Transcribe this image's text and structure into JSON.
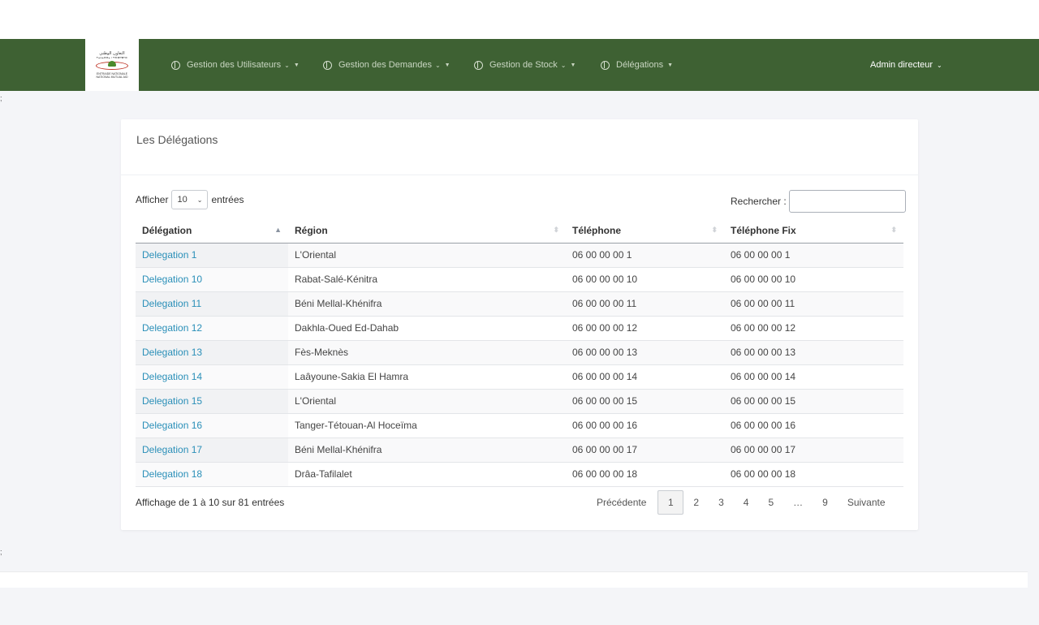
{
  "navbar": {
    "logo": {
      "arabic": "التعاون الوطني",
      "latin": "ⵜⴰⵡⴰⵙⵙⴰ ⵏ ⵜⵙⵏⵓⵖⵓⵢⵉⵏ",
      "name_line1": "ENTRAIDE NATIONALE",
      "name_line2": "NATIONAL MUTUAL AID"
    },
    "items": [
      {
        "label": "Gestion des Utilisateurs",
        "icon": "globe-icon"
      },
      {
        "label": "Gestion des Demandes",
        "icon": "globe-icon"
      },
      {
        "label": "Gestion de Stock",
        "icon": "globe-icon"
      },
      {
        "label": "Délégations",
        "icon": "globe-icon"
      }
    ],
    "user": "Admin directeur",
    "bg_color": "#3e6133"
  },
  "stray_marks": [
    ";",
    ";"
  ],
  "card": {
    "title": "Les Délégations",
    "length": {
      "prefix": "Afficher",
      "value": "10",
      "suffix": "entrées"
    },
    "search": {
      "label": "Rechercher :",
      "value": ""
    },
    "columns": [
      "Délégation",
      "Région",
      "Téléphone",
      "Téléphone Fix"
    ],
    "rows": [
      [
        "Delegation 1",
        "L'Oriental",
        "06 00 00 00 1",
        "06 00 00 00 1"
      ],
      [
        "Delegation 10",
        "Rabat-Salé-Kénitra",
        "06 00 00 00 10",
        "06 00 00 00 10"
      ],
      [
        "Delegation 11",
        "Béni Mellal-Khénifra",
        "06 00 00 00 11",
        "06 00 00 00 11"
      ],
      [
        "Delegation 12",
        "Dakhla-Oued Ed-Dahab",
        "06 00 00 00 12",
        "06 00 00 00 12"
      ],
      [
        "Delegation 13",
        "Fès-Meknès",
        "06 00 00 00 13",
        "06 00 00 00 13"
      ],
      [
        "Delegation 14",
        "Laâyoune-Sakia El Hamra",
        "06 00 00 00 14",
        "06 00 00 00 14"
      ],
      [
        "Delegation 15",
        "L'Oriental",
        "06 00 00 00 15",
        "06 00 00 00 15"
      ],
      [
        "Delegation 16",
        "Tanger-Tétouan-Al Hoceïma",
        "06 00 00 00 16",
        "06 00 00 00 16"
      ],
      [
        "Delegation 17",
        "Béni Mellal-Khénifra",
        "06 00 00 00 17",
        "06 00 00 00 17"
      ],
      [
        "Delegation 18",
        "Drâa-Tafilalet",
        "06 00 00 00 18",
        "06 00 00 00 18"
      ]
    ],
    "info": "Affichage de 1 à 10 sur 81 entrées",
    "pagination": {
      "previous": "Précédente",
      "pages": [
        "1",
        "2",
        "3",
        "4",
        "5",
        "…",
        "9"
      ],
      "current": "1",
      "next": "Suivante"
    },
    "link_color": "#2a8fb8"
  }
}
